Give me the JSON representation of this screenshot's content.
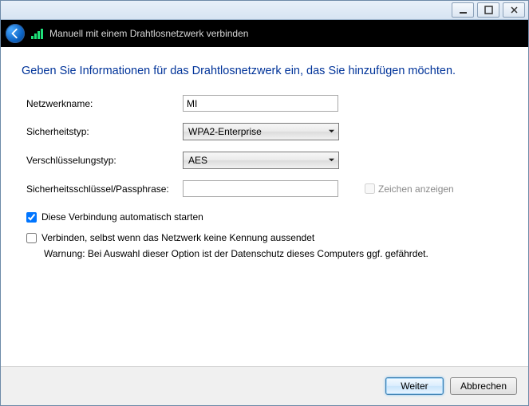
{
  "window": {
    "chrome_min_tip": "Minimieren",
    "chrome_max_tip": "Maximieren",
    "chrome_close_tip": "Schließen"
  },
  "header": {
    "title": "Manuell mit einem Drahtlosnetzwerk verbinden"
  },
  "instruction": "Geben Sie Informationen für das Drahtlosnetzwerk ein, das Sie hinzufügen möchten.",
  "form": {
    "network_name_label": "Netzwerkname:",
    "network_name_value": "MI",
    "security_type_label": "Sicherheitstyp:",
    "security_type_value": "WPA2-Enterprise",
    "encryption_type_label": "Verschlüsselungstyp:",
    "encryption_type_value": "AES",
    "passphrase_label": "Sicherheitsschlüssel/Passphrase:",
    "passphrase_value": "",
    "show_chars_label": "Zeichen anzeigen",
    "auto_start_label": "Diese Verbindung automatisch starten",
    "auto_start_checked": true,
    "connect_hidden_label": "Verbinden, selbst wenn das Netzwerk keine Kennung aussendet",
    "connect_hidden_checked": false,
    "warning": "Warnung: Bei Auswahl dieser Option ist der Datenschutz dieses Computers ggf. gefährdet."
  },
  "footer": {
    "next": "Weiter",
    "cancel": "Abbrechen"
  }
}
